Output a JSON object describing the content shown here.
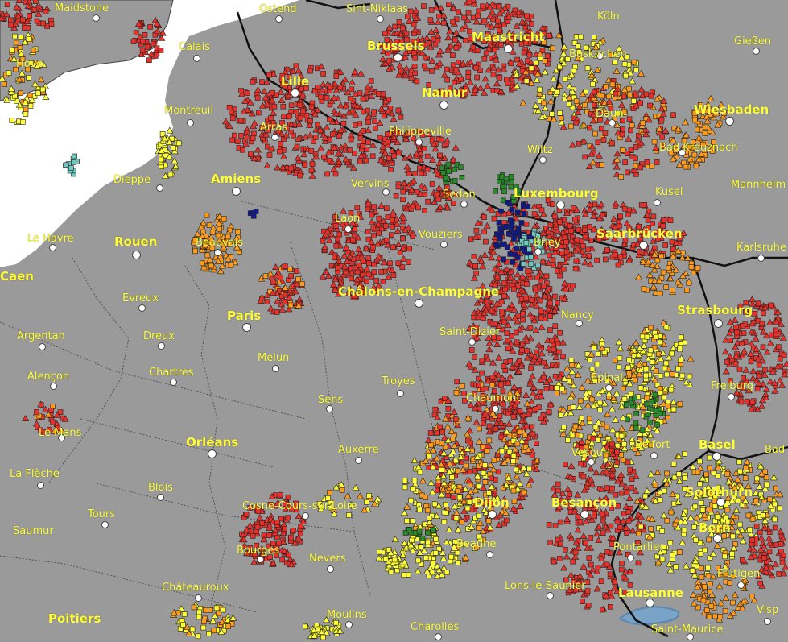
{
  "colors": {
    "land": "#9a9a9a",
    "sea": "#ffffff",
    "lake": "#7aa3c8",
    "border": "#111111",
    "admin_border": "#555555",
    "label": "#ffff33",
    "marker_red": "#e8312a",
    "marker_orange": "#ff9a1a",
    "marker_yellow": "#ffff33",
    "marker_green": "#2b8a2b",
    "marker_navy": "#101a88",
    "marker_teal": "#6fc7bf"
  },
  "legend_marker_shapes": [
    "square",
    "triangle"
  ],
  "cities": [
    {
      "id": "maidstone",
      "name": "Maidstone",
      "major": false
    },
    {
      "id": "ostend",
      "name": "Ostend",
      "major": false
    },
    {
      "id": "sint-niklaas",
      "name": "Sint-Niklaas",
      "major": false
    },
    {
      "id": "koln",
      "name": "Köln",
      "major": false
    },
    {
      "id": "calais",
      "name": "Calais",
      "major": false
    },
    {
      "id": "brussels",
      "name": "Brussels",
      "major": true
    },
    {
      "id": "maastricht",
      "name": "Maastricht",
      "major": true
    },
    {
      "id": "giessen",
      "name": "Gießen",
      "major": false
    },
    {
      "id": "hove",
      "name": "Hove",
      "major": false
    },
    {
      "id": "buskirchen",
      "name": "Buskirchen",
      "major": false
    },
    {
      "id": "lille",
      "name": "Lille",
      "major": true
    },
    {
      "id": "namur",
      "name": "Namur",
      "major": true
    },
    {
      "id": "montreuil",
      "name": "Montreuil",
      "major": false
    },
    {
      "id": "daun",
      "name": "Daun",
      "major": false
    },
    {
      "id": "wiesbaden",
      "name": "Wiesbaden",
      "major": true
    },
    {
      "id": "arras",
      "name": "Arras",
      "major": false
    },
    {
      "id": "philippeville",
      "name": "Philippeville",
      "major": false
    },
    {
      "id": "wiltz",
      "name": "Wiltz",
      "major": false
    },
    {
      "id": "bad-kreuznach",
      "name": "Bad Kreuznach",
      "major": false
    },
    {
      "id": "dieppe",
      "name": "Dieppe",
      "major": false
    },
    {
      "id": "amiens",
      "name": "Amiens",
      "major": true
    },
    {
      "id": "vervins",
      "name": "Vervins",
      "major": false
    },
    {
      "id": "sedan",
      "name": "Sedan",
      "major": false
    },
    {
      "id": "luxembourg",
      "name": "Luxembourg",
      "major": true
    },
    {
      "id": "kusel",
      "name": "Kusel",
      "major": false
    },
    {
      "id": "mannheim",
      "name": "Mannheim",
      "major": false
    },
    {
      "id": "laon",
      "name": "Laon",
      "major": false
    },
    {
      "id": "le-havre",
      "name": "Le Havre",
      "major": false
    },
    {
      "id": "rouen",
      "name": "Rouen",
      "major": true
    },
    {
      "id": "beauvais",
      "name": "Beauvais",
      "major": false
    },
    {
      "id": "vouziers",
      "name": "Vouziers",
      "major": false
    },
    {
      "id": "briey",
      "name": "Briey",
      "major": false
    },
    {
      "id": "saarbrucken",
      "name": "Saarbrücken",
      "major": true
    },
    {
      "id": "karlsruhe",
      "name": "Karlsruhe",
      "major": false
    },
    {
      "id": "caen",
      "name": "Caen",
      "major": true
    },
    {
      "id": "chalons",
      "name": "Châlons-en-Champagne",
      "major": true
    },
    {
      "id": "evreux",
      "name": "Évreux",
      "major": false
    },
    {
      "id": "paris",
      "name": "Paris",
      "major": true
    },
    {
      "id": "nancy",
      "name": "Nancy",
      "major": false
    },
    {
      "id": "strasbourg",
      "name": "Strasbourg",
      "major": true
    },
    {
      "id": "argentan",
      "name": "Argentan",
      "major": false
    },
    {
      "id": "dreux",
      "name": "Dreux",
      "major": false
    },
    {
      "id": "saint-dizier",
      "name": "Saint-Dizier",
      "major": false
    },
    {
      "id": "melun",
      "name": "Melun",
      "major": false
    },
    {
      "id": "alencon",
      "name": "Alençon",
      "major": false
    },
    {
      "id": "chartres",
      "name": "Chartres",
      "major": false
    },
    {
      "id": "troyes",
      "name": "Troyes",
      "major": false
    },
    {
      "id": "epinal",
      "name": "Épinal",
      "major": false
    },
    {
      "id": "freiburg",
      "name": "Freiburg",
      "major": false
    },
    {
      "id": "chaumont",
      "name": "Chaumont",
      "major": false
    },
    {
      "id": "sens",
      "name": "Sens",
      "major": false
    },
    {
      "id": "le-mans",
      "name": "Le Mans",
      "major": false
    },
    {
      "id": "orleans",
      "name": "Orléans",
      "major": true
    },
    {
      "id": "belfort",
      "name": "Belfort",
      "major": false
    },
    {
      "id": "basel",
      "name": "Basel",
      "major": true
    },
    {
      "id": "bad",
      "name": "Bad",
      "major": false
    },
    {
      "id": "auxerre",
      "name": "Auxerre",
      "major": false
    },
    {
      "id": "vesoul",
      "name": "Vesoul",
      "major": false
    },
    {
      "id": "la-fleche",
      "name": "La Flèche",
      "major": false
    },
    {
      "id": "blois",
      "name": "Blois",
      "major": false
    },
    {
      "id": "solothurn",
      "name": "Solothurn",
      "major": true
    },
    {
      "id": "dijon",
      "name": "Dijon",
      "major": true
    },
    {
      "id": "besancon",
      "name": "Besançon",
      "major": true
    },
    {
      "id": "cosne",
      "name": "Cosne-Cours-sur-Loire",
      "major": false
    },
    {
      "id": "tours",
      "name": "Tours",
      "major": false
    },
    {
      "id": "bern",
      "name": "Bern",
      "major": true
    },
    {
      "id": "saumur",
      "name": "Saumur",
      "major": false
    },
    {
      "id": "beaune",
      "name": "Beaune",
      "major": false
    },
    {
      "id": "pontarlier",
      "name": "Pontarlier",
      "major": false
    },
    {
      "id": "bourges",
      "name": "Bourges",
      "major": false
    },
    {
      "id": "nevers",
      "name": "Nevers",
      "major": false
    },
    {
      "id": "frutigen",
      "name": "Frutigen",
      "major": false
    },
    {
      "id": "lons",
      "name": "Lons-le-Saunier",
      "major": false
    },
    {
      "id": "chateauroux",
      "name": "Châteauroux",
      "major": false
    },
    {
      "id": "lausanne",
      "name": "Lausanne",
      "major": true
    },
    {
      "id": "poitiers",
      "name": "Poitiers",
      "major": true
    },
    {
      "id": "moulins",
      "name": "Moulins",
      "major": false
    },
    {
      "id": "visp",
      "name": "Visp",
      "major": false
    },
    {
      "id": "charolles",
      "name": "Charolles",
      "major": false
    },
    {
      "id": "saint-maurice",
      "name": "Saint-Maurice",
      "major": false
    }
  ]
}
